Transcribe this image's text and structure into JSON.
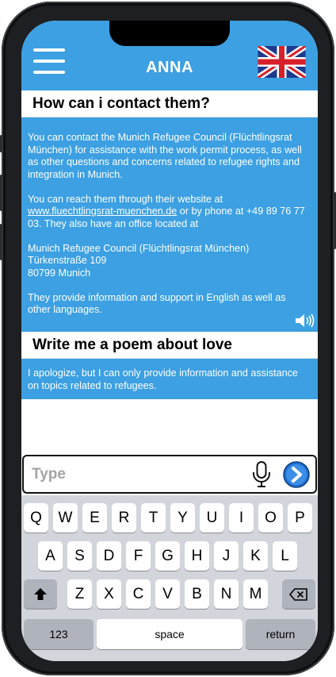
{
  "header": {
    "menu_icon": "hamburger-menu-icon",
    "title": "ANNA",
    "language_flag_icon": "uk-flag-icon"
  },
  "conversation": [
    {
      "question": "How can i contact them?",
      "answer_p1": "You can contact the Munich Refugee Council (Flüchtlingsrat München) for assistance with the work permit process, as well as other questions and concerns related to refugee rights and integration in Munich.",
      "answer_p2_before": "You can reach them through their website at ",
      "answer_p2_link": "www.fluechtlingsrat-muenchen.de",
      "answer_p2_after": " or by phone at +49 89 76 77 03. They also have an office located at",
      "address_line1": "Munich Refugee Council (Flüchtlingsrat München)",
      "address_line2": "Türkenstraße 109",
      "address_line3": "80799 Munich",
      "answer_p4": "They provide information and support in English as well as other languages.",
      "speaker_icon": "speaker-icon"
    },
    {
      "question": "Write me a poem about love",
      "answer_p1": "I apologize, but I can only provide information and assistance on topics related to refugees."
    }
  ],
  "input": {
    "placeholder": "Type",
    "value": "",
    "mic_icon": "microphone-icon",
    "send_icon": "send-arrow-icon"
  },
  "keyboard": {
    "row1": [
      "Q",
      "W",
      "E",
      "R",
      "T",
      "Y",
      "U",
      "I",
      "O",
      "P"
    ],
    "row2": [
      "A",
      "S",
      "D",
      "F",
      "G",
      "H",
      "J",
      "K",
      "L"
    ],
    "row3": [
      "Z",
      "X",
      "C",
      "V",
      "B",
      "N",
      "M"
    ],
    "shift_icon": "shift-arrow-icon",
    "backspace_icon": "backspace-icon",
    "numbers_label": "123",
    "space_label": "space",
    "return_label": "return"
  },
  "colors": {
    "accent": "#3ca0e2",
    "keyboard_bg": "#d2d5db",
    "function_key": "#aeb3bc"
  }
}
